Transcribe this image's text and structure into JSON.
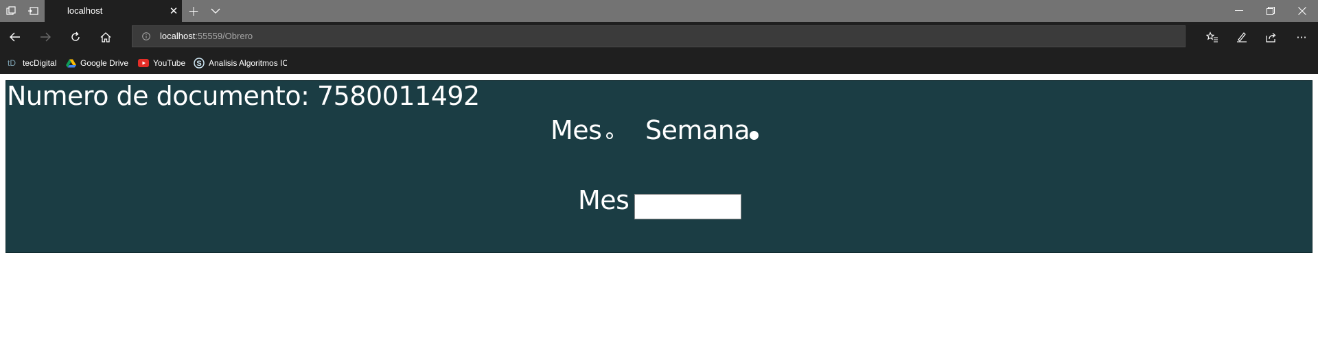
{
  "browser": {
    "tab": {
      "title": "localhost",
      "close_glyph": "✕"
    },
    "new_tab_glyph": "+",
    "window_controls": {
      "minimize": "—",
      "restore": "❐",
      "close": "✕"
    },
    "address": {
      "host": "localhost",
      "rest": ":55559/Obrero"
    },
    "favorites": [
      {
        "label": "tecDigital",
        "icon": "td-logo-icon"
      },
      {
        "label": "Google Drive",
        "icon": "google-drive-icon"
      },
      {
        "label": "YouTube",
        "icon": "youtube-icon"
      },
      {
        "label": "Analisis Algoritmos IC",
        "icon": "s-logo-icon"
      }
    ],
    "favorite_icon_text": {
      "td": "tD",
      "s": "S"
    },
    "more_glyph": "···"
  },
  "page": {
    "doc_label": "Numero de documento: 7580011492",
    "radios": [
      {
        "label": "Mes",
        "selected": false
      },
      {
        "label": "Semana",
        "selected": true
      }
    ],
    "month_label": "Mes",
    "month_input_value": ""
  },
  "colors": {
    "panel_bg": "#1b3d44",
    "browser_chrome": "#1f1f1f",
    "tab_strip": "#737373"
  }
}
